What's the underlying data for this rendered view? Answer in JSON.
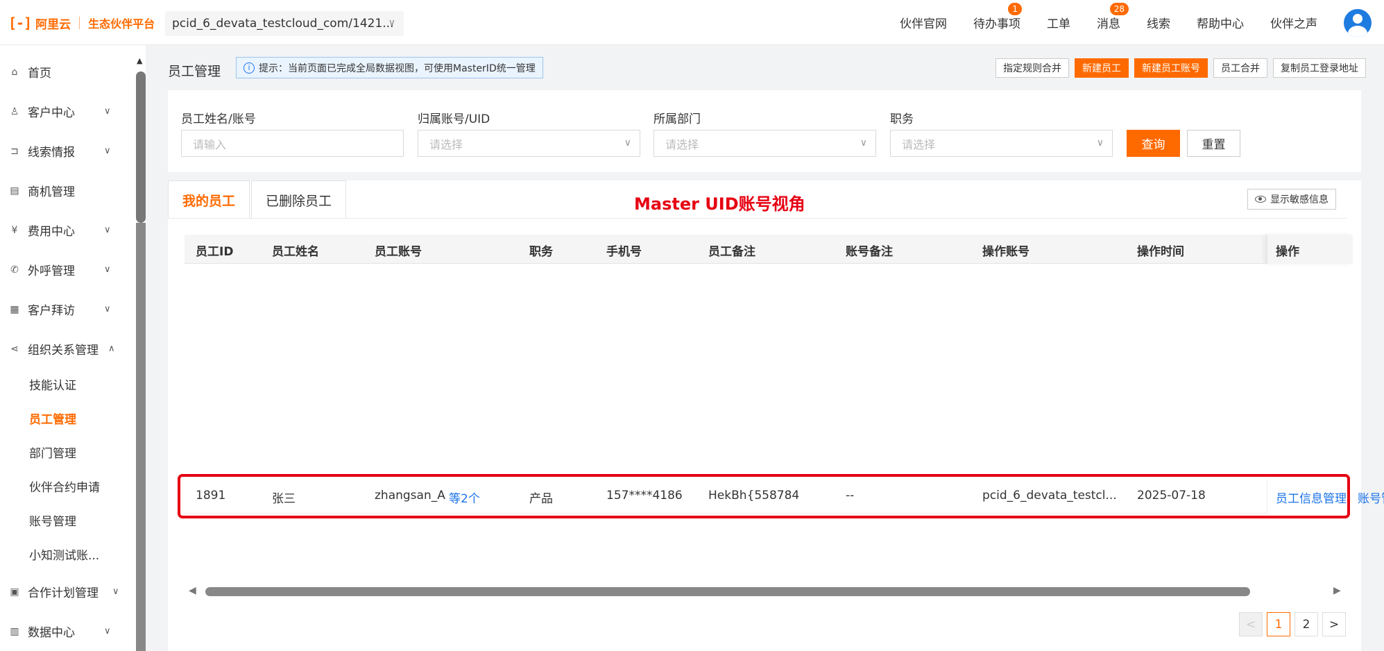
{
  "brand": {
    "logo_mark": "[-]",
    "logo_name": "阿里云",
    "platform": "生态伙伴平台"
  },
  "account_selector": {
    "value": "pcid_6_devata_testcloud_com/1421..."
  },
  "nav": {
    "items": [
      {
        "label": "伙伴官网",
        "badge": null
      },
      {
        "label": "待办事项",
        "badge": "1"
      },
      {
        "label": "工单",
        "badge": null
      },
      {
        "label": "消息",
        "badge": "28"
      },
      {
        "label": "线索",
        "badge": null
      },
      {
        "label": "帮助中心",
        "badge": null
      },
      {
        "label": "伙伴之声",
        "badge": null
      }
    ]
  },
  "sidebar": {
    "items": [
      {
        "label": "首页",
        "icon": "home-icon"
      },
      {
        "label": "客户中心",
        "icon": "customer-icon"
      },
      {
        "label": "线索情报",
        "icon": "lead-icon"
      },
      {
        "label": "商机管理",
        "icon": "opportunity-icon"
      },
      {
        "label": "费用中心",
        "icon": "billing-icon"
      },
      {
        "label": "外呼管理",
        "icon": "phone-icon"
      },
      {
        "label": "客户拜访",
        "icon": "calendar-icon"
      },
      {
        "label": "组织关系管理",
        "icon": "org-icon"
      },
      {
        "label": "合作计划管理",
        "icon": "plan-icon"
      },
      {
        "label": "数据中心",
        "icon": "data-icon"
      }
    ],
    "subitems": [
      "技能认证",
      "员工管理",
      "部门管理",
      "伙伴合约申请",
      "账号管理",
      "小知测试账..."
    ]
  },
  "page": {
    "title": "员工管理",
    "hint": "提示：当前页面已完成全局数据视图，可使用MasterID统一管理",
    "actions": [
      "指定规则合并",
      "新建员工",
      "新建员工账号",
      "员工合并",
      "复制员工登录地址"
    ]
  },
  "filters": {
    "name_label": "员工姓名/账号",
    "name_placeholder": "请输入",
    "uid_label": "归属账号/UID",
    "uid_placeholder": "请选择",
    "dept_label": "所属部门",
    "dept_placeholder": "请选择",
    "role_label": "职务",
    "role_placeholder": "请选择",
    "query": "查询",
    "reset": "重置"
  },
  "tabs": [
    "我的员工",
    "已删除员工"
  ],
  "annotation": "Master UID账号视角",
  "sensitive": "显示敏感信息",
  "table": {
    "headers": [
      "员工ID",
      "员工姓名",
      "员工账号",
      "职务",
      "手机号",
      "员工备注",
      "账号备注",
      "操作账号",
      "操作时间",
      "操作"
    ],
    "row": {
      "id": "1891",
      "name": "张三",
      "account": "zhangsan_A",
      "more": "等2个",
      "role": "产品",
      "phone": "157****4186",
      "note": "HekBh{558784",
      "acct_note": "--",
      "op_account": "pcid_6_devata_testcl...",
      "op_time": "2025-07-18",
      "op1": "员工信息管理",
      "op2": "账号管理"
    }
  },
  "pagination": {
    "prev": "<",
    "pages": [
      "1",
      "2"
    ],
    "next": ">"
  }
}
